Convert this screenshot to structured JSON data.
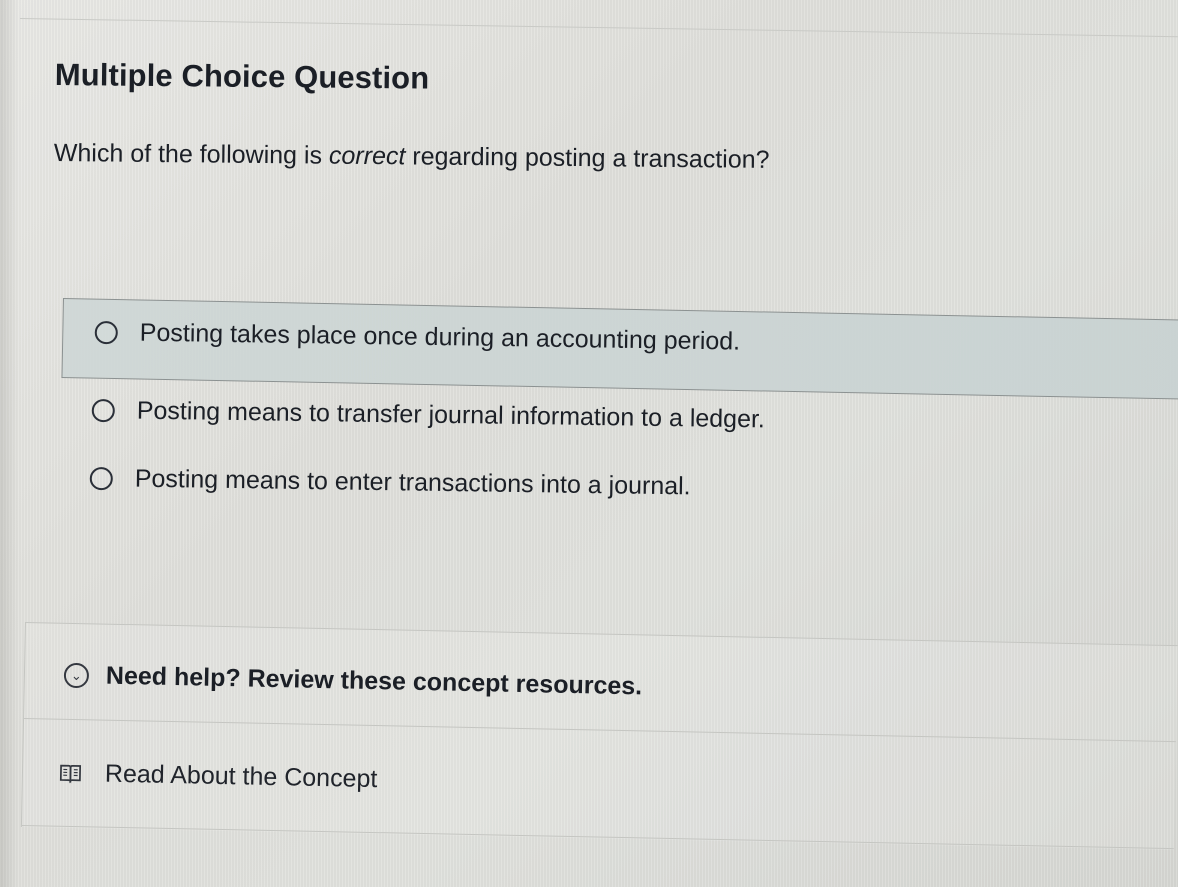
{
  "question": {
    "heading": "Multiple Choice Question",
    "prompt_before": "Which of the following is ",
    "prompt_emphasis": "correct",
    "prompt_after": " regarding posting a transaction?"
  },
  "options": [
    {
      "label": "Posting takes place once during an accounting period."
    },
    {
      "label": "Posting means to transfer journal information to a ledger."
    },
    {
      "label": "Posting means to enter transactions into a journal."
    }
  ],
  "resources": {
    "help_label": "Need help? Review these concept resources.",
    "read_label": "Read About the Concept"
  },
  "icons": {
    "help_icon": "chevron-down-circle-icon",
    "read_icon": "book-icon"
  },
  "colors": {
    "highlight": "#cdd6d5",
    "text": "#1b1f26"
  }
}
